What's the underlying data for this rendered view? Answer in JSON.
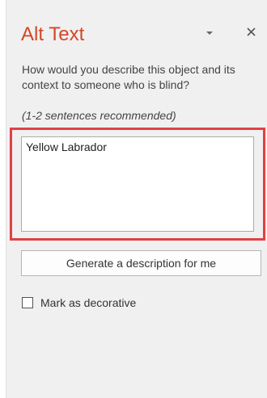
{
  "pane": {
    "title": "Alt Text",
    "options_icon": "chevron-down-icon",
    "close_icon": "close-icon",
    "question": "How would you describe this object and its context to someone who is blind?",
    "hint": "(1-2 sentences recommended)",
    "description_value": "Yellow Labrador",
    "generate_button_label": "Generate a description for me",
    "decorative_checkbox_label": "Mark as decorative",
    "decorative_checked": false
  },
  "colors": {
    "title": "#d24726",
    "pane_background": "#f0f0f0",
    "highlight_border": "#e04046"
  }
}
